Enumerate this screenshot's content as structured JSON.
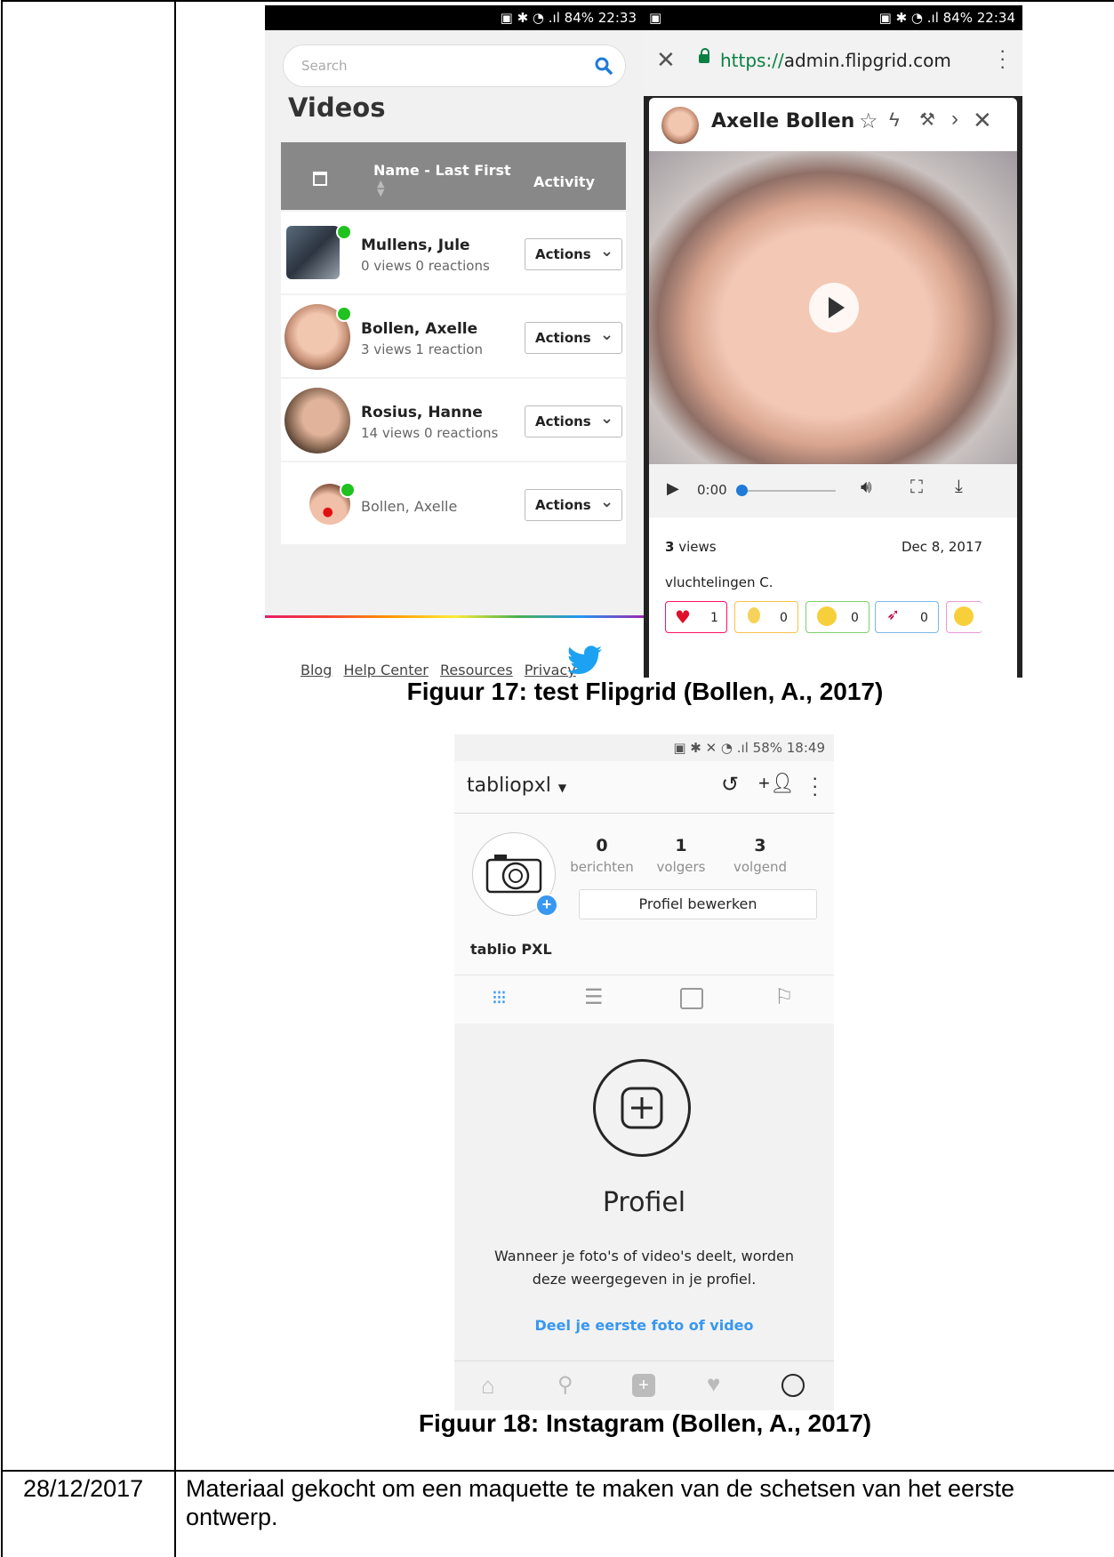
{
  "table": {
    "row2": {
      "date": "28/12/2017",
      "text": "Materiaal gekocht om een maquette te maken van de schetsen van het eerste ontwerp."
    }
  },
  "figure17": {
    "caption": "Figuur 17: test Flipgrid (Bollen, A., 2017)",
    "left_status": "84% 22:33",
    "right_status": "84% 22:34",
    "search_placeholder": "Search",
    "videos_title": "Videos",
    "table_head": {
      "name": "Name - Last First",
      "activity": "Activity"
    },
    "rows": [
      {
        "name": "Mullens, Jule",
        "sub": "0 views 0 reactions",
        "action": "Actions"
      },
      {
        "name": "Bollen, Axelle",
        "sub": "3 views 1 reaction",
        "action": "Actions"
      },
      {
        "name": "Rosius, Hanne",
        "sub": "14 views 0 reactions",
        "action": "Actions"
      },
      {
        "name": "Bollen, Axelle",
        "sub": "",
        "action": "Actions"
      }
    ],
    "footer_links": [
      "Blog",
      "Help Center",
      "Resources",
      "Privacy"
    ],
    "url": {
      "scheme": "https://",
      "host": "admin.flipgrid.com"
    },
    "card": {
      "name": "Axelle Bollen",
      "time": "0:00",
      "views_num": "3",
      "views_lbl": " views",
      "date": "Dec 8, 2017",
      "title": "vluchtelingen C.",
      "reactions": [
        "1",
        "0",
        "0",
        "0"
      ]
    }
  },
  "figure18": {
    "caption": "Figuur 18: Instagram (Bollen, A., 2017)",
    "status": "58% 18:49",
    "username": "tabliopxl",
    "stats": [
      {
        "num": "0",
        "label": "berichten"
      },
      {
        "num": "1",
        "label": "volgers"
      },
      {
        "num": "3",
        "label": "volgend"
      }
    ],
    "edit_button": "Profiel bewerken",
    "display_name": "tablio PXL",
    "empty_title": "Profiel",
    "empty_text_1": "Wanneer je foto's of video's deelt, worden",
    "empty_text_2": "deze weergegeven in je profiel.",
    "empty_link": "Deel je eerste foto of video"
  },
  "colors": {
    "ig_blue": "#3897f0",
    "online_green": "#1fc21f",
    "url_green": "#0b8043"
  }
}
